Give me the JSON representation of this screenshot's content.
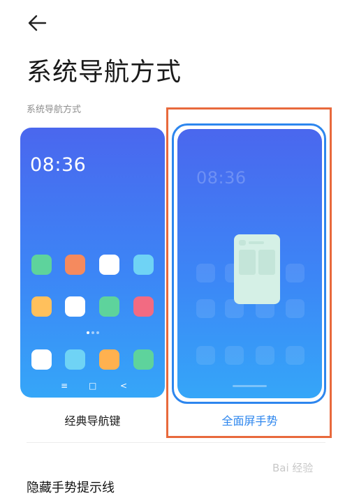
{
  "header": {
    "title": "系统导航方式"
  },
  "section_label": "系统导航方式",
  "options": [
    {
      "label": "经典导航键",
      "clock": "08:36",
      "apps": [
        "#5ed39c",
        "#f58a5e",
        "#ffffff",
        "#6fd3f5",
        "#ffc05c",
        "#ffffff",
        "#5ed39c",
        "#f26b82",
        "#ffffff",
        "#6fd3f5",
        "#ffb14f",
        "#5ed39c"
      ],
      "nav_icons": [
        "≡",
        "□",
        "<"
      ],
      "selected": false
    },
    {
      "label": "全面屏手势",
      "clock": "08:36",
      "selected": true
    }
  ],
  "hide_gesture_hint": {
    "label": "隐藏手势提示线"
  },
  "watermark": "Bai 经验",
  "colors": {
    "accent": "#2d86ee",
    "highlight": "#e8693c",
    "card_top": "#4a67ee",
    "card_bottom": "#35a6f8"
  }
}
